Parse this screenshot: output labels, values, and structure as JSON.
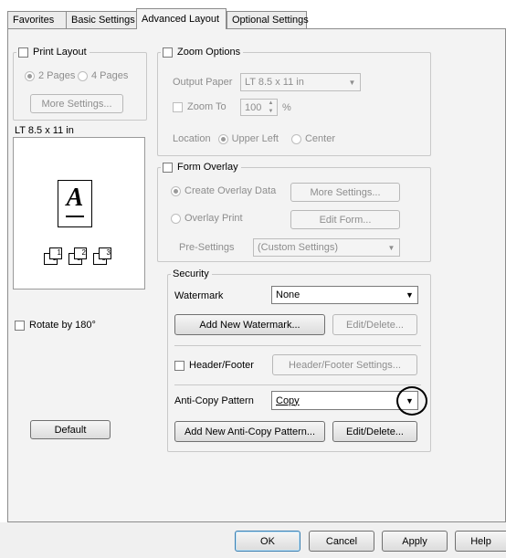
{
  "tabs": [
    "Favorites",
    "Basic Settings",
    "Advanced Layout",
    "Optional Settings"
  ],
  "print_layout": {
    "label": "Print Layout",
    "checked": false,
    "pages_2": "2 Pages",
    "pages_4": "4 Pages",
    "selected": "2 Pages",
    "more_settings": "More Settings..."
  },
  "preview": {
    "paper_label": "LT 8.5 x 11 in",
    "letter": "A",
    "copies": [
      "1",
      "2",
      "3"
    ]
  },
  "rotate": {
    "label": "Rotate by 180°",
    "checked": false
  },
  "default_button": "Default",
  "zoom": {
    "label": "Zoom Options",
    "checked": false,
    "output_paper_label": "Output Paper",
    "output_paper_value": "LT 8.5 x 11 in",
    "zoom_to_label": "Zoom To",
    "zoom_value": "100",
    "percent": "%",
    "location_label": "Location",
    "upper_left": "Upper Left",
    "center": "Center"
  },
  "form_overlay": {
    "label": "Form Overlay",
    "checked": false,
    "create_label": "Create Overlay Data",
    "more_settings": "More Settings...",
    "overlay_print": "Overlay Print",
    "edit_form": "Edit Form...",
    "presettings_label": "Pre-Settings",
    "presettings_value": "(Custom Settings)"
  },
  "security": {
    "label": "Security",
    "watermark_label": "Watermark",
    "watermark_value": "None",
    "add_watermark": "Add New Watermark...",
    "edit_delete_1": "Edit/Delete...",
    "header_footer_label": "Header/Footer",
    "header_footer_checked": false,
    "header_footer_settings": "Header/Footer Settings...",
    "anticopy_label": "Anti-Copy Pattern",
    "anticopy_value": "Copy",
    "add_anticopy": "Add New Anti-Copy Pattern...",
    "edit_delete_2": "Edit/Delete..."
  },
  "footer_buttons": {
    "ok": "OK",
    "cancel": "Cancel",
    "apply": "Apply",
    "help": "Help"
  },
  "icons": [
    "chevron-down-icon",
    "spin-up-icon",
    "spin-down-icon",
    "page-preview-icon",
    "collate-pages-icon"
  ]
}
